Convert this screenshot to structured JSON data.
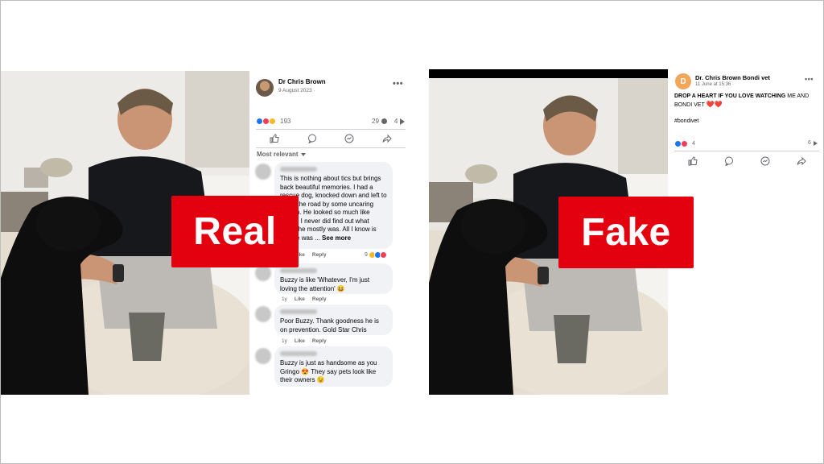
{
  "labels": {
    "real": "Real",
    "fake": "Fake"
  },
  "real_post": {
    "author": "Dr Chris Brown",
    "date": "9 August 2023 ·",
    "reaction_count": "193",
    "comment_count": "29",
    "share_count": "4",
    "sort_label": "Most relevant",
    "comments": [
      {
        "text": "This is nothing about tics but brings back beautiful memories. I had a rescue dog, knocked down and left to die in the road by some uncaring person. He looked so much like Buzzy. I never did find out what breed he mostly was. All I know is that he was ...",
        "see_more": "See more",
        "like": "Like",
        "reply": "Reply",
        "time": "1y",
        "reactions": "9"
      },
      {
        "text": "Buzzy is like 'Whatever, I'm just loving the attention' 😆",
        "like": "Like",
        "reply": "Reply",
        "time": "1y"
      },
      {
        "text": "Poor Buzzy. Thank goodness he is on prevention. Gold Star Chris",
        "like": "Like",
        "reply": "Reply",
        "time": "1y"
      },
      {
        "text": "Buzzy is just as handsome as you Gringo 😍 They say pets look like their owners 😉",
        "like": "Like",
        "reply": "Reply",
        "time": "1y"
      }
    ]
  },
  "fake_post": {
    "author": "Dr. Chris Brown Bondi vet",
    "avatar_letter": "D",
    "date": "11 June at 15:36 ·",
    "text_caps": "DROP A HEART IF YOU LOVE WATCHING",
    "text_rest": "ME AND BONDI VET",
    "hearts": "❤️❤️",
    "hashtag": "#bondivet",
    "reaction_count": "4",
    "share_count": "6"
  },
  "colors": {
    "stamp": "#e3000f",
    "like_blue": "#1877f2",
    "love_red": "#f33e58",
    "fb_gray": "#65676b"
  }
}
